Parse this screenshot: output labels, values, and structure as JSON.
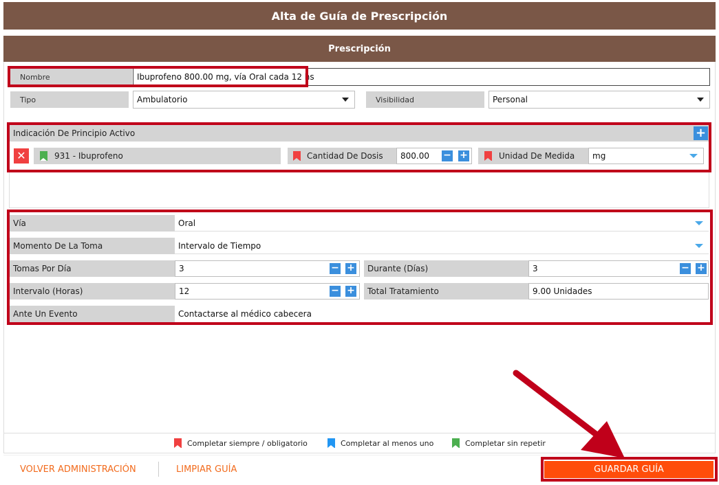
{
  "header": {
    "title": "Alta de Guía de Prescripción"
  },
  "section": {
    "title": "Prescripción"
  },
  "form": {
    "nombre_label": "Nombre",
    "nombre_value": "Ibuprofeno 800.00 mg, vía Oral cada 12 hs",
    "tipo_label": "Tipo",
    "tipo_value": "Ambulatorio",
    "visibilidad_label": "Visibilidad",
    "visibilidad_value": "Personal"
  },
  "principio": {
    "header": "Indicación De Principio Activo",
    "item": "931 - Ibuprofeno",
    "cantidad_label": "Cantidad De Dosis",
    "cantidad_value": "800.00",
    "unidad_label": "Unidad De Medida",
    "unidad_value": "mg"
  },
  "detalle": {
    "via_label": "Vía",
    "via_value": "Oral",
    "momento_label": "Momento De La Toma",
    "momento_value": "Intervalo de Tiempo",
    "tomas_label": "Tomas Por Día",
    "tomas_value": "3",
    "durante_label": "Durante (Días)",
    "durante_value": "3",
    "intervalo_label": "Intervalo (Horas)",
    "intervalo_value": "12",
    "total_label": "Total Tratamiento",
    "total_value": "9.00 Unidades",
    "evento_label": "Ante Un Evento",
    "evento_value": "Contactarse al médico cabecera"
  },
  "legend": {
    "red": "Completar siempre / obligatorio",
    "blue": "Completar al menos uno",
    "green": "Completar sin repetir"
  },
  "footer": {
    "volver": "VOLVER ADMINISTRACIÓN",
    "limpiar": "LIMPIAR GUÍA",
    "guardar": "GUARDAR GUÍA"
  },
  "icons": {
    "remove": "close-icon",
    "add": "plus-icon",
    "increment": "plus-icon",
    "decrement": "minus-icon",
    "dropdown": "chevron-down-icon"
  },
  "colors": {
    "header_bg": "#7a5747",
    "label_bg": "#d4d4d4",
    "accent_blue": "#3b8fdd",
    "action_orange": "#ff4d0a",
    "highlight_red": "#c0001a"
  }
}
